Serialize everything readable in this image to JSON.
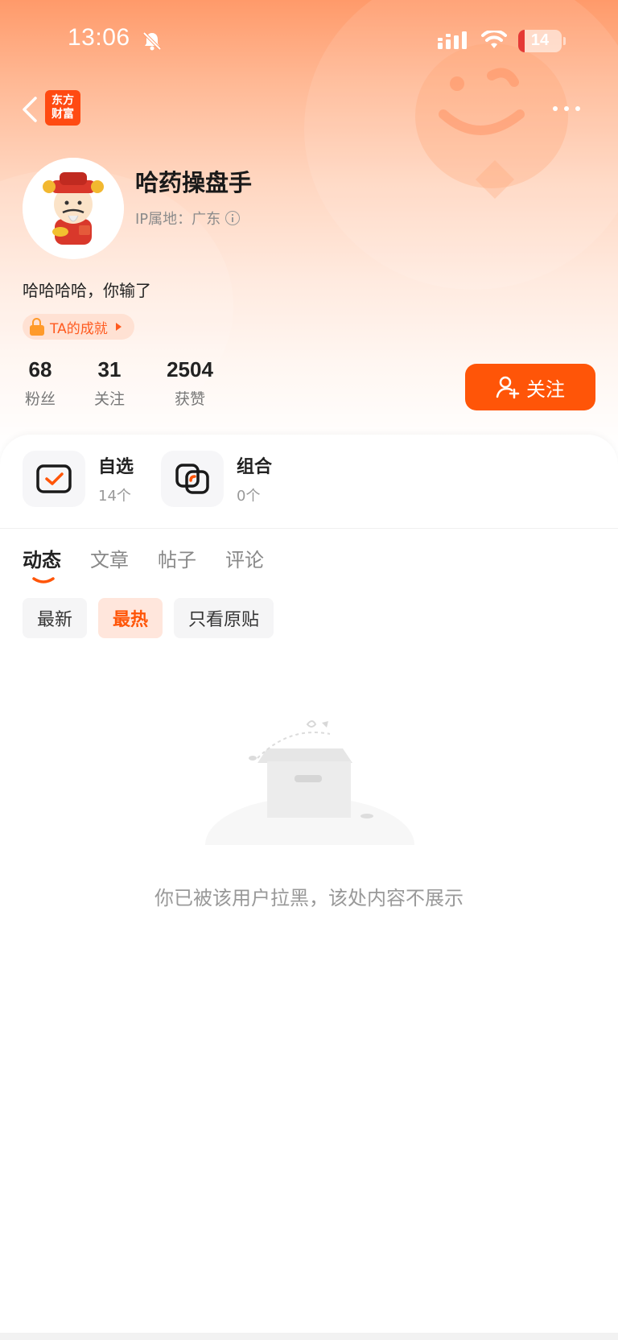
{
  "status_bar": {
    "time": "13:06",
    "battery": "14"
  },
  "header": {
    "logo_line1": "东方",
    "logo_line2": "财富"
  },
  "profile": {
    "username": "哈药操盘手",
    "ip_label": "IP属地：广东",
    "bio": "哈哈哈哈，你输了",
    "achievement": "TA的成就",
    "stats": {
      "fans": {
        "value": "68",
        "label": "粉丝"
      },
      "following": {
        "value": "31",
        "label": "关注"
      },
      "likes": {
        "value": "2504",
        "label": "获赞"
      }
    },
    "follow_button": "关注"
  },
  "quick_links": [
    {
      "title": "自选",
      "sub": "14个"
    },
    {
      "title": "组合",
      "sub": "0个"
    }
  ],
  "tabs": [
    "动态",
    "文章",
    "帖子",
    "评论"
  ],
  "filters": [
    "最新",
    "最热",
    "只看原贴"
  ],
  "empty_state": {
    "message": "你已被该用户拉黑，该处内容不展示"
  },
  "colors": {
    "accent": "#ff5508",
    "hero_top": "#ff9a6a",
    "logo": "#ff4a12"
  }
}
